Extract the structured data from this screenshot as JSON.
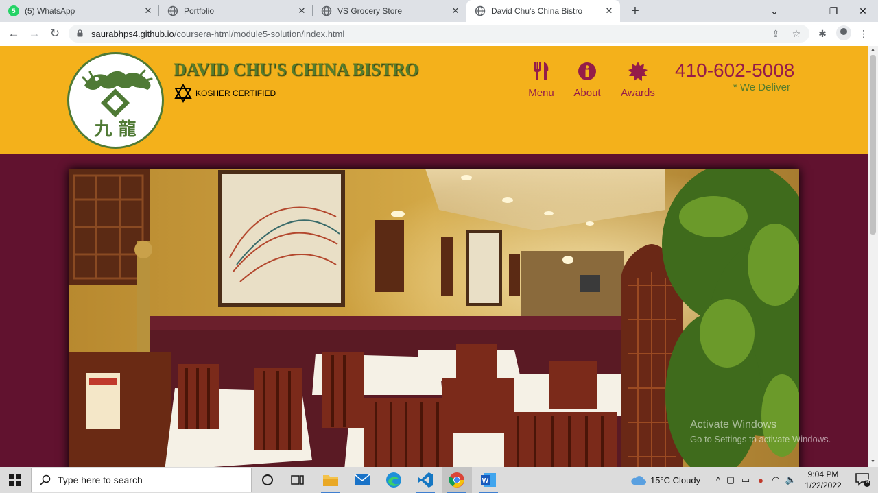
{
  "browser": {
    "tabs": [
      {
        "title": "(5) WhatsApp",
        "badge": "5",
        "favicon": "whatsapp-icon",
        "active": false
      },
      {
        "title": "Portfolio",
        "favicon": "globe-icon",
        "active": false
      },
      {
        "title": "VS Grocery Store",
        "favicon": "globe-icon",
        "active": false
      },
      {
        "title": "David Chu's China Bistro",
        "favicon": "globe-icon",
        "active": true
      }
    ],
    "url_host": "saurabhps4.github.io",
    "url_path": "/coursera-html/module5-solution/index.html"
  },
  "site": {
    "brand": "DAVID CHU'S CHINA BISTRO",
    "kosher": "KOSHER CERTIFIED",
    "nav": [
      {
        "label": "Menu",
        "icon": "cutlery-icon"
      },
      {
        "label": "About",
        "icon": "info-icon"
      },
      {
        "label": "Awards",
        "icon": "certificate-icon"
      }
    ],
    "phone": "410-602-5008",
    "delivery": "* We Deliver",
    "logo_chars": "九 龍"
  },
  "watermark": {
    "line1": "Activate Windows",
    "line2": "Go to Settings to activate Windows."
  },
  "taskbar": {
    "search_placeholder": "Type here to search",
    "weather": "15°C  Cloudy",
    "time": "9:04 PM",
    "date": "1/22/2022",
    "notifications": "8"
  },
  "colors": {
    "header_bg": "#f4b11b",
    "page_bg": "#61122f",
    "brand_green": "#557c2c",
    "nav_maroon": "#951c49"
  }
}
